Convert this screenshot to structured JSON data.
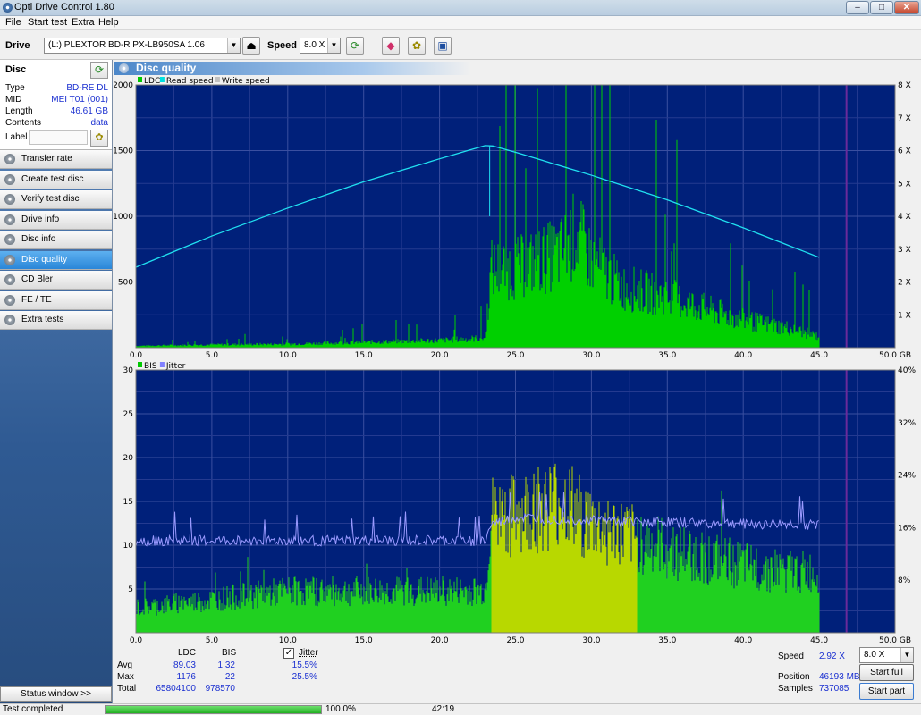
{
  "window": {
    "title": "Opti Drive Control 1.80"
  },
  "menu": [
    "File",
    "Start test",
    "Extra",
    "Help"
  ],
  "toolbar": {
    "drive_label": "Drive",
    "drive_value": "(L:)  PLEXTOR BD-R  PX-LB950SA 1.06",
    "speed_label": "Speed",
    "speed_value": "8.0 X"
  },
  "disc": {
    "heading": "Disc",
    "rows": [
      {
        "key": "Type",
        "value": "BD-RE DL"
      },
      {
        "key": "MID",
        "value": "MEI T01 (001)"
      },
      {
        "key": "Length",
        "value": "46.61 GB"
      },
      {
        "key": "Contents",
        "value": "data"
      }
    ],
    "label_key": "Label"
  },
  "nav": [
    {
      "label": "Transfer rate",
      "active": false
    },
    {
      "label": "Create test disc",
      "active": false
    },
    {
      "label": "Verify test disc",
      "active": false
    },
    {
      "label": "Drive info",
      "active": false
    },
    {
      "label": "Disc info",
      "active": false
    },
    {
      "label": "Disc quality",
      "active": true
    },
    {
      "label": "CD Bler",
      "active": false
    },
    {
      "label": "FE / TE",
      "active": false
    },
    {
      "label": "Extra tests",
      "active": false
    }
  ],
  "status_window_label": "Status window >>",
  "panel_title": "Disc quality",
  "chart_data": [
    {
      "type": "line",
      "legend": [
        "LDC",
        "Read speed",
        "Write speed"
      ],
      "legend_colors": [
        "#00c800",
        "#00e0e0",
        "#c0c0c0"
      ],
      "xlim": [
        0,
        50
      ],
      "ylim": [
        0,
        2000
      ],
      "y2lim": [
        0,
        8
      ],
      "x_ticks": [
        "0.0",
        "5.0",
        "10.0",
        "15.0",
        "20.0",
        "25.0",
        "30.0",
        "35.0",
        "40.0",
        "45.0",
        "50.0 GB"
      ],
      "y_ticks": [
        "500",
        "1000",
        "1500",
        "2000"
      ],
      "y2_ticks": [
        "1 X",
        "2 X",
        "3 X",
        "4 X",
        "5 X",
        "6 X",
        "7 X",
        "8 X"
      ],
      "series": [
        {
          "name": "Read speed",
          "x": [
            0,
            5,
            10,
            15,
            20,
            23.2,
            25,
            30,
            35,
            40,
            45
          ],
          "y": [
            2.45,
            3.4,
            4.25,
            5.05,
            5.75,
            6.18,
            5.95,
            5.25,
            4.5,
            3.65,
            2.75
          ]
        },
        {
          "name": "LDC",
          "x": [
            0,
            5,
            10,
            15,
            20,
            23,
            23.4,
            25,
            28,
            29,
            30,
            32,
            35,
            38,
            40,
            43,
            45
          ],
          "y": [
            15,
            25,
            30,
            45,
            60,
            80,
            650,
            650,
            780,
            950,
            720,
            500,
            420,
            300,
            230,
            160,
            90
          ]
        }
      ]
    },
    {
      "type": "line",
      "legend": [
        "BIS",
        "Jitter"
      ],
      "legend_colors": [
        "#00c800",
        "#8080ff"
      ],
      "xlim": [
        0,
        50
      ],
      "ylim": [
        0,
        30
      ],
      "y2lim": [
        0,
        40
      ],
      "x_ticks": [
        "0.0",
        "5.0",
        "10.0",
        "15.0",
        "20.0",
        "25.0",
        "30.0",
        "35.0",
        "40.0",
        "45.0",
        "50.0 GB"
      ],
      "y_ticks": [
        "5",
        "10",
        "15",
        "20",
        "25",
        "30"
      ],
      "y2_ticks": [
        "8%",
        "16%",
        "24%",
        "32%",
        "40%"
      ],
      "series": [
        {
          "name": "Jitter",
          "x": [
            0,
            5,
            10,
            15,
            20,
            23,
            23.4,
            25,
            30,
            35,
            40,
            45
          ],
          "y": [
            14.0,
            14.0,
            14.0,
            14.0,
            14.0,
            14.0,
            16.5,
            17.5,
            17.2,
            16.8,
            16.6,
            16.5
          ]
        },
        {
          "name": "BIS",
          "x": [
            0,
            5,
            10,
            15,
            20,
            23,
            23.4,
            25,
            28,
            30,
            35,
            40,
            45
          ],
          "y": [
            3,
            4,
            5,
            5,
            5,
            5,
            14,
            14,
            16,
            13,
            10,
            8,
            7
          ]
        }
      ]
    }
  ],
  "stats": {
    "col_ldc": "LDC",
    "col_bis": "BIS",
    "col_jitter": "Jitter",
    "row_avg": "Avg",
    "row_max": "Max",
    "row_total": "Total",
    "avg_ldc": "89.03",
    "avg_bis": "1.32",
    "avg_jitter": "15.5%",
    "max_ldc": "1176",
    "max_bis": "22",
    "max_jitter": "25.5%",
    "total_ldc": "65804100",
    "total_bis": "978570",
    "jitter_checked": true
  },
  "right_stats": {
    "speed_label": "Speed",
    "speed_value": "2.92 X",
    "speed_select": "8.0 X",
    "position_label": "Position",
    "position_value": "46193 MB",
    "samples_label": "Samples",
    "samples_value": "737085",
    "start_full": "Start full",
    "start_part": "Start part"
  },
  "statusbar": {
    "status_text": "Test completed",
    "progress": 100,
    "progress_text": "100.0%",
    "time": "42:19"
  }
}
